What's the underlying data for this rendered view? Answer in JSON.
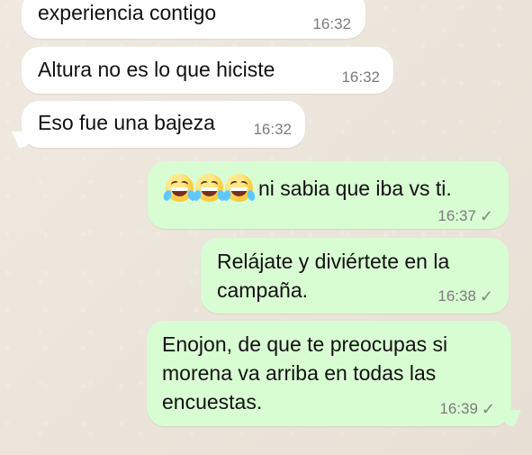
{
  "messages": [
    {
      "text": "experiencia contigo",
      "time": "16:32"
    },
    {
      "text": "Altura no es lo que hiciste",
      "time": "16:32"
    },
    {
      "text": "Eso fue una bajeza",
      "time": "16:32"
    },
    {
      "emoji_count": 3,
      "emoji_icon": "laughing-crying-face-icon",
      "text": "ni sabia que iba vs ti.",
      "time": "16:37",
      "status": "✓"
    },
    {
      "text": "Relájate y diviértete en la\ncampaña.",
      "time": "16:38",
      "status": "✓"
    },
    {
      "text": "Enojon, de que te preocupas si\nmorena va arriba en todas las\nencuestas.",
      "time": "16:39",
      "status": "✓"
    }
  ],
  "colors": {
    "background": "#ece6dd",
    "incoming": "#ffffff",
    "outgoing": "#d9fdd3",
    "time": "#7b7b7b"
  }
}
